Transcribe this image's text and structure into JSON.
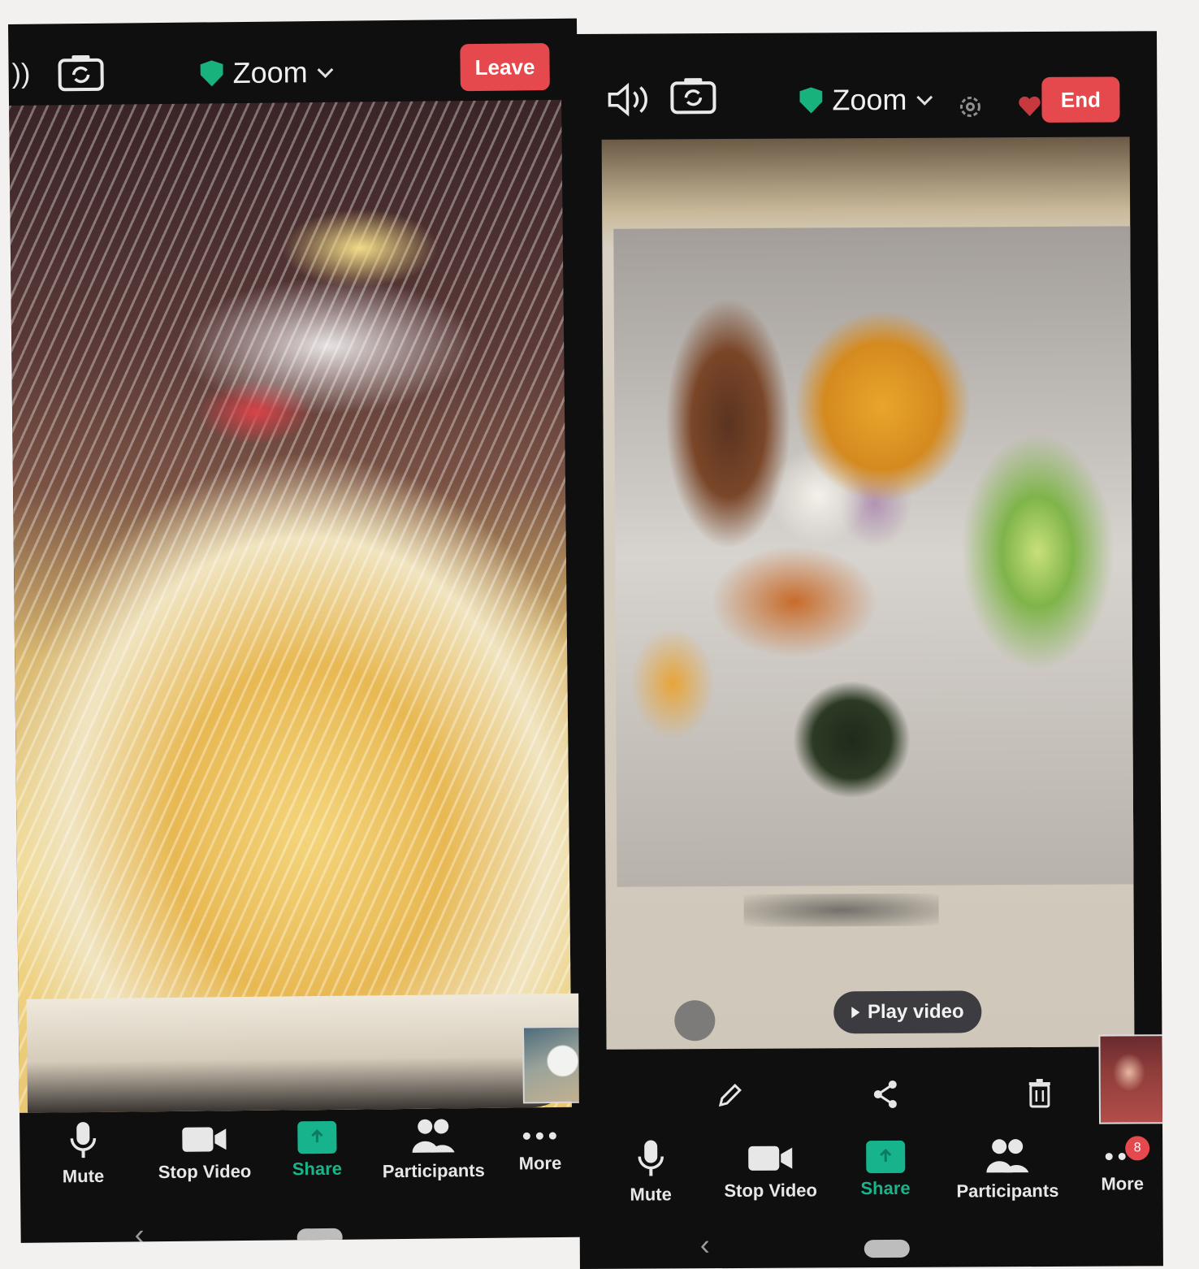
{
  "left_phone": {
    "meeting_title": "Zoom",
    "leave_label": "Leave",
    "toolbar": [
      {
        "label": "Mute",
        "icon": "microphone-icon"
      },
      {
        "label": "Stop Video",
        "icon": "video-camera-icon"
      },
      {
        "label": "Share",
        "icon": "share-screen-icon"
      },
      {
        "label": "Participants",
        "icon": "participants-icon"
      },
      {
        "label": "More",
        "icon": "more-dots-icon"
      }
    ]
  },
  "right_phone": {
    "meeting_title": "Zoom",
    "end_label": "End",
    "play_video_label": "Play video",
    "more_badge": "8",
    "toolbar": [
      {
        "label": "Mute",
        "icon": "microphone-icon"
      },
      {
        "label": "Stop Video",
        "icon": "video-camera-icon"
      },
      {
        "label": "Share",
        "icon": "share-screen-icon"
      },
      {
        "label": "Participants",
        "icon": "participants-icon"
      },
      {
        "label": "More",
        "icon": "more-dots-icon"
      }
    ]
  },
  "colors": {
    "accent_green": "#17b38c",
    "leave_red": "#e5484d",
    "shield_green": "#18b37c"
  }
}
